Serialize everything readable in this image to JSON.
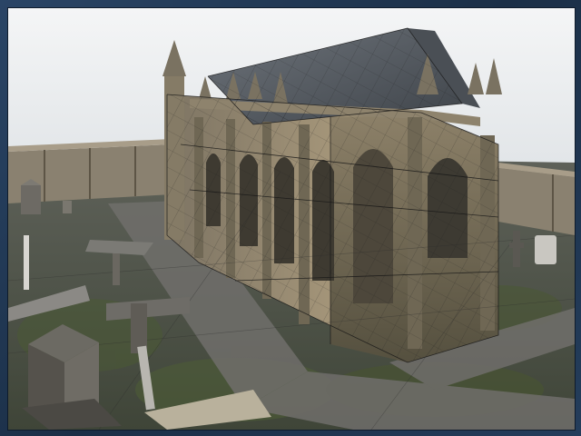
{
  "scene": {
    "subject": "gothic-chapel-wireframe-render",
    "colors": {
      "sky": "#eef0f1",
      "ground": "#56594c",
      "grass": "#4f5a3d",
      "path": "#6d6c6a",
      "wall_stone": "#9a8e7a",
      "roof": "#565b61",
      "wire": "#1a1a1a",
      "frame": "#1f3550"
    }
  }
}
